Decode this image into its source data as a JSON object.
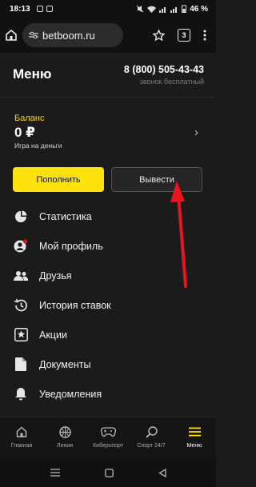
{
  "status_bar": {
    "time": "18:13",
    "battery": "46 %"
  },
  "browser": {
    "url": "betboom.ru",
    "tab_count": "3"
  },
  "header": {
    "title": "Меню",
    "phone": "8 (800) 505-43-43",
    "phone_note": "звонок бесплатный"
  },
  "balance": {
    "label": "Баланс",
    "amount": "0 ₽",
    "subtitle": "Игра на деньги"
  },
  "buttons": {
    "deposit": "Пополнить",
    "withdraw": "Вывести"
  },
  "menu": {
    "items": [
      {
        "label": "Статистика",
        "icon": "pie-chart-icon"
      },
      {
        "label": "Мой профиль",
        "icon": "profile-icon"
      },
      {
        "label": "Друзья",
        "icon": "friends-icon"
      },
      {
        "label": "История ставок",
        "icon": "history-icon"
      },
      {
        "label": "Акции",
        "icon": "star-icon"
      },
      {
        "label": "Документы",
        "icon": "document-icon"
      },
      {
        "label": "Уведомления",
        "icon": "bell-icon"
      }
    ]
  },
  "bottom_nav": {
    "items": [
      {
        "label": "Главная",
        "icon": "home-icon"
      },
      {
        "label": "Линия",
        "icon": "ball-icon"
      },
      {
        "label": "Киберспорт",
        "icon": "gamepad-icon"
      },
      {
        "label": "Спорт 24/7",
        "icon": "racket-icon"
      },
      {
        "label": "Меню",
        "icon": "menu-icon"
      }
    ],
    "active": "Меню"
  },
  "colors": {
    "accent": "#ffe10b",
    "background": "#1b1b1b",
    "annotation": "#e8141e"
  }
}
